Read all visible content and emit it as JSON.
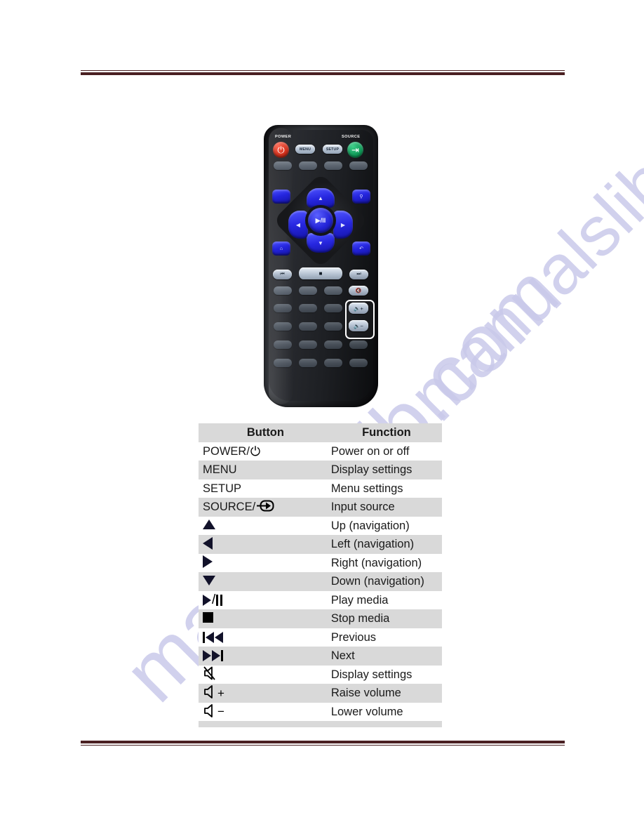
{
  "page": {
    "background_color": "#ffffff",
    "rule_color": "#4a2022",
    "watermark_text": "manualslib.com",
    "watermark_color": "#c9c9ea"
  },
  "remote": {
    "label_power": "POWER",
    "label_source": "SOURCE",
    "buttons": {
      "power": "⏻",
      "source": "⇥",
      "menu": "MENU",
      "setup": "SETUP",
      "up": "▲",
      "down": "▼",
      "left": "◀",
      "right": "▶",
      "play_pause": "▶/II",
      "previous": "|◀◀",
      "next": "▶▶|",
      "stop": "■",
      "mute": "🔇",
      "volume_up": "🔈+",
      "volume_down": "🔈−"
    },
    "highlight": "volume-buttons"
  },
  "table": {
    "headers": {
      "button": "Button",
      "function": "Function"
    },
    "rows": [
      {
        "button_text": "POWER/",
        "button_icon": "power-icon",
        "function": "Power on or off"
      },
      {
        "button_text": "MENU",
        "button_icon": "",
        "function": "Display settings"
      },
      {
        "button_text": "SETUP",
        "button_icon": "",
        "function": "Menu settings"
      },
      {
        "button_text": "SOURCE/",
        "button_icon": "source-icon",
        "function": "Input source"
      },
      {
        "button_text": "",
        "button_icon": "arrow-up-icon",
        "function": "Up (navigation)"
      },
      {
        "button_text": "",
        "button_icon": "arrow-left-icon",
        "function": "Left (navigation)"
      },
      {
        "button_text": "",
        "button_icon": "arrow-right-icon",
        "function": "Right (navigation)"
      },
      {
        "button_text": "",
        "button_icon": "arrow-down-icon",
        "function": "Down (navigation)"
      },
      {
        "button_text": "",
        "button_icon": "play-pause-icon",
        "function": "Play media"
      },
      {
        "button_text": "",
        "button_icon": "stop-icon",
        "function": "Stop media"
      },
      {
        "button_text": "",
        "button_icon": "previous-icon",
        "function": "Previous"
      },
      {
        "button_text": "",
        "button_icon": "next-icon",
        "function": "Next"
      },
      {
        "button_text": "",
        "button_icon": "mute-icon",
        "function": "Display settings"
      },
      {
        "button_text": "",
        "button_icon": "volume-up-icon",
        "function": "Raise volume"
      },
      {
        "button_text": "",
        "button_icon": "volume-down-icon",
        "function": "Lower volume"
      }
    ]
  }
}
